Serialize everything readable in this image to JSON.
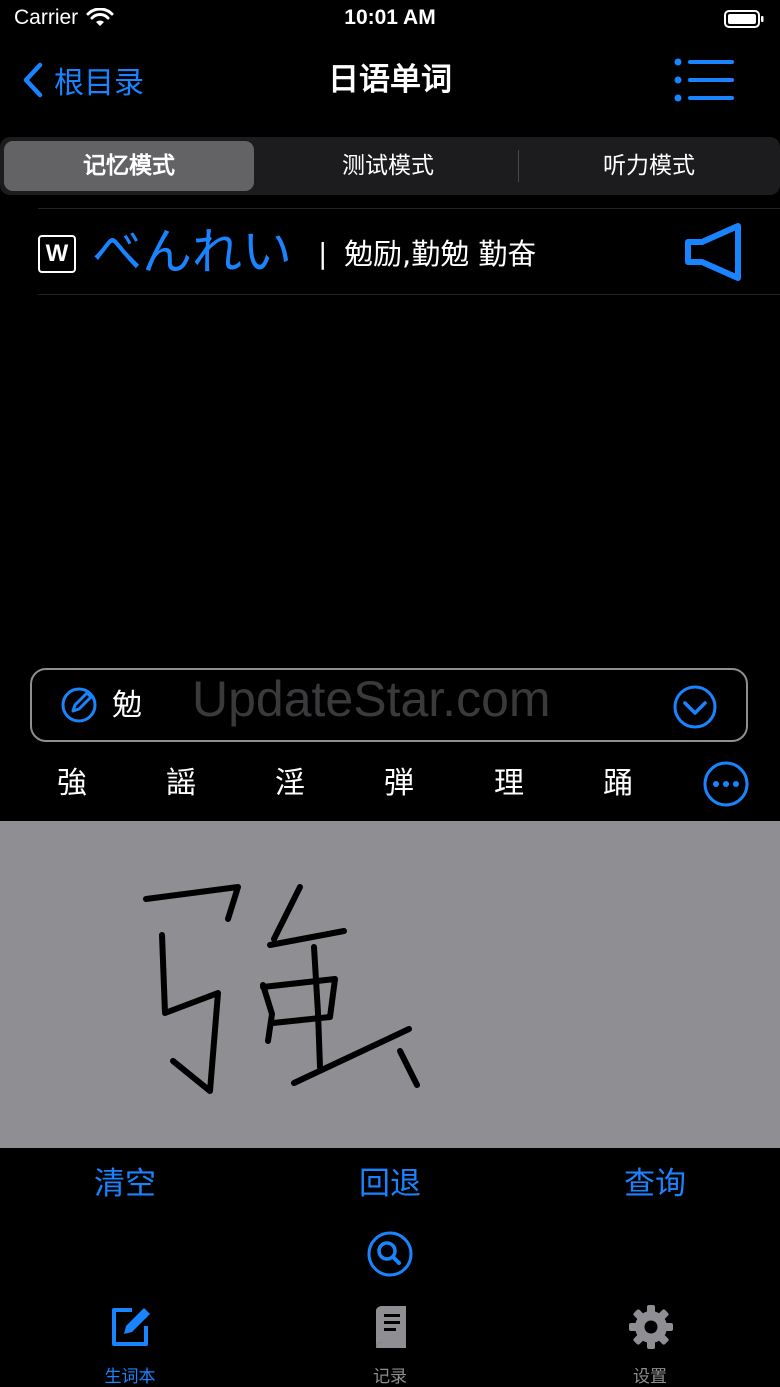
{
  "status_bar": {
    "carrier": "Carrier",
    "time": "10:01 AM"
  },
  "nav": {
    "back_label": "根目录",
    "title": "日语单词"
  },
  "segments": [
    "记忆模式",
    "测试模式",
    "听力模式"
  ],
  "word": {
    "badge": "W",
    "kana": "べんれい",
    "separator": "|",
    "meaning": "勉励,勤勉 勤奋"
  },
  "input": {
    "value": "勉",
    "watermark": "UpdateStar.com"
  },
  "candidates": [
    "強",
    "謡",
    "淫",
    "弾",
    "理",
    "踊"
  ],
  "actions": {
    "clear": "清空",
    "undo": "回退",
    "query": "查询"
  },
  "tabs": [
    "生词本",
    "记录",
    "设置"
  ],
  "colors": {
    "accent": "#1a84ff",
    "canvas": "#8e8e93",
    "inactive": "#8e8e93"
  }
}
